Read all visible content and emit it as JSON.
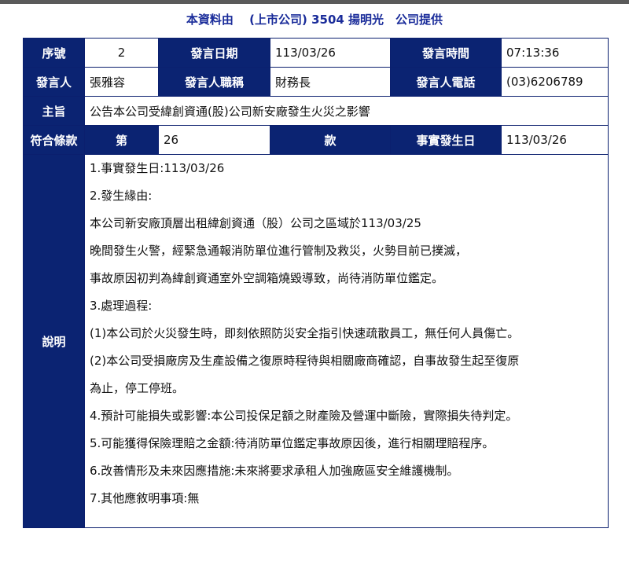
{
  "source": "本資料由　 (上市公司) 3504 揚明光　公司提供",
  "labels": {
    "seq": "序號",
    "date": "發言日期",
    "time": "發言時間",
    "speaker": "發言人",
    "title": "發言人職稱",
    "phone": "發言人電話",
    "subject": "主旨",
    "rule": "符合條款",
    "di": "第",
    "kuan": "款",
    "fact_date": "事實發生日",
    "desc": "說明"
  },
  "values": {
    "seq": "2",
    "date": "113/03/26",
    "time": "07:13:36",
    "speaker": "張雅容",
    "title": "財務長",
    "phone": "(03)6206789",
    "subject": "公告本公司受緯創資通(股)公司新安廠發生火災之影響",
    "rule_no": "26",
    "kuan": "",
    "fact_date": "113/03/26"
  },
  "description": [
    "1.事實發生日:113/03/26",
    "2.發生緣由:",
    "本公司新安廠頂層出租緯創資通（股）公司之區域於113/03/25",
    "晚間發生火警，經緊急通報消防單位進行管制及救災，火勢目前已撲滅，",
    "事故原因初判為緯創資通室外空調箱燒毀導致，尚待消防單位鑑定。",
    "3.處理過程:",
    "(1)本公司於火災發生時，即刻依照防災安全指引快速疏散員工，無任何人員傷亡。",
    "(2)本公司受損廠房及生產設備之復原時程待與相關廠商確認，自事故發生起至復原",
    "為止，停工停班。",
    "4.預計可能損失或影響:本公司投保足額之財產險及營運中斷險，實際損失待判定。",
    "5.可能獲得保險理賠之金額:待消防單位鑑定事故原因後，進行相關理賠程序。",
    "6.改善情形及未來因應措施:未來將要求承租人加強廠區安全維護機制。",
    "7.其他應敘明事項:無"
  ],
  "colors": {
    "header_bg": "#0b2372",
    "title_text": "#1a2c9a"
  }
}
